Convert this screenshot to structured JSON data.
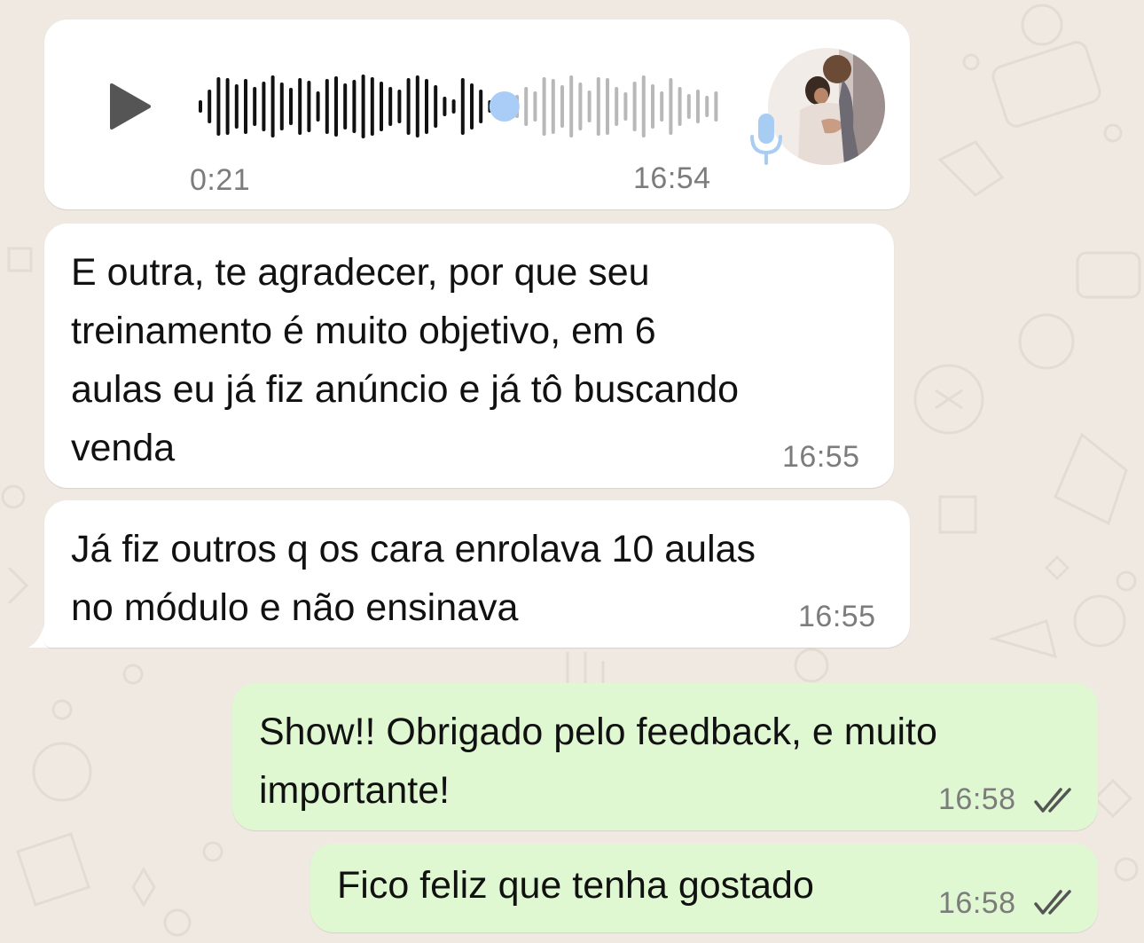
{
  "chat": {
    "voice_message": {
      "duration": "0:21",
      "time": "16:54",
      "played_fraction": 0.58,
      "icons": [
        "play-icon",
        "microphone-icon"
      ],
      "colors": {
        "played": "#111111",
        "unplayed": "#b8b8b8",
        "scrubber": "#a9cdf6",
        "mic": "#a8cdf3"
      }
    },
    "messages": [
      {
        "direction": "incoming",
        "text": "E outra, te agradecer, por que seu\ntreinamento é muito objetivo, em 6\naulas eu já fiz anúncio e já tô buscando\nvenda",
        "time": "16:55"
      },
      {
        "direction": "incoming",
        "text": "Já fiz outros q os cara enrolava 10 aulas\nno módulo e não ensinava",
        "time": "16:55"
      },
      {
        "direction": "outgoing",
        "text": "Show!! Obrigado pelo feedback, e muito\nimportante!",
        "time": "16:58",
        "status": "read"
      },
      {
        "direction": "outgoing",
        "text": "Fico feliz que tenha gostado",
        "time": "16:58",
        "status": "read"
      }
    ]
  },
  "colors": {
    "background": "#efe9e1",
    "incoming_bubble": "#ffffff",
    "outgoing_bubble": "#dff8d2",
    "timestamp": "#7c7c7c"
  }
}
